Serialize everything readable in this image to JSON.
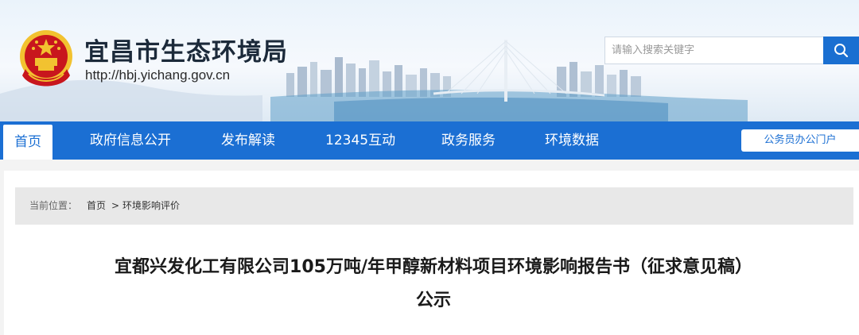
{
  "header": {
    "site_title": "宜昌市生态环境局",
    "site_url": "http://hbj.yichang.gov.cn",
    "emblem_icon": "national-emblem-icon"
  },
  "search": {
    "placeholder": "请输入搜索关键字",
    "button_icon": "search-icon"
  },
  "nav": {
    "items": [
      {
        "label": "首页",
        "active": true
      },
      {
        "label": "政府信息公开"
      },
      {
        "label": "发布解读"
      },
      {
        "label": "12345互动"
      },
      {
        "label": "政务服务"
      },
      {
        "label": "环境数据"
      }
    ],
    "portal_label": "公务员办公门户"
  },
  "breadcrumb": {
    "prefix": "当前位置：",
    "home": "首页",
    "separator": ">",
    "current": "环境影响评价"
  },
  "article": {
    "title_line1": "宜都兴发化工有限公司105万吨/年甲醇新材料项目环境影响报告书（征求意见稿）",
    "title_line2": "公示"
  },
  "colors": {
    "nav_blue": "#1b6fd3",
    "search_blue": "#1a6fd1",
    "emblem_red": "#c8161d",
    "emblem_gold": "#f2c230"
  }
}
